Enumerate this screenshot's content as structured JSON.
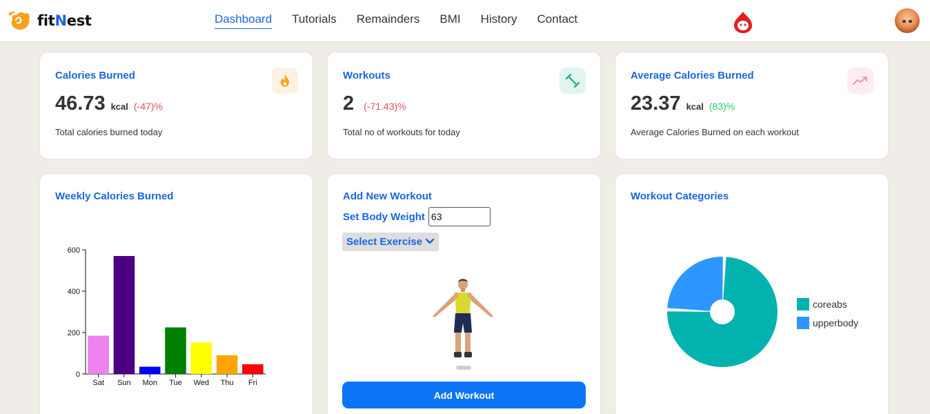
{
  "app": {
    "logo_prefix": "fit",
    "logo_accent": "N",
    "logo_suffix": "est"
  },
  "nav": {
    "items": [
      {
        "label": "Dashboard",
        "active": true
      },
      {
        "label": "Tutorials",
        "active": false
      },
      {
        "label": "Remainders",
        "active": false
      },
      {
        "label": "BMI",
        "active": false
      },
      {
        "label": "History",
        "active": false
      },
      {
        "label": "Contact",
        "active": false
      }
    ]
  },
  "stats": {
    "calories": {
      "title": "Calories Burned",
      "value": "46.73",
      "unit": "kcal",
      "change": "(-47)%",
      "desc": "Total calories burned today",
      "icon": "fire-icon"
    },
    "workouts": {
      "title": "Workouts",
      "value": "2",
      "unit": "",
      "change": "(-71.43)%",
      "desc": "Total no of workouts for today",
      "icon": "dumbbell-icon"
    },
    "average": {
      "title": "Average Calories Burned",
      "value": "23.37",
      "unit": "kcal",
      "change": "(83)%",
      "desc": "Average Calories Burned on each workout",
      "icon": "trending-up-icon"
    }
  },
  "weekly": {
    "title": "Weekly Calories Burned"
  },
  "add_workout": {
    "title": "Add New Workout",
    "body_weight_label": "Set Body Weight",
    "body_weight_value": "63",
    "select_label": "Select Exercise",
    "button_label": "Add Workout"
  },
  "categories": {
    "title": "Workout Categories"
  },
  "colors": {
    "accent": "#1a66e0",
    "negative": "#e05252",
    "positive": "#28c76f",
    "button": "#0d74f5"
  },
  "chart_data": [
    {
      "type": "bar",
      "title": "Weekly Calories Burned",
      "categories": [
        "Sat",
        "Sun",
        "Mon",
        "Tue",
        "Wed",
        "Thu",
        "Fri"
      ],
      "values": [
        185,
        570,
        35,
        225,
        152,
        90,
        47
      ],
      "colors": [
        "#ee82ee",
        "#4b0082",
        "#0000ff",
        "#008000",
        "#ffff00",
        "#ffa500",
        "#ff0000"
      ],
      "yticks": [
        0,
        200,
        400,
        600
      ],
      "ylim": [
        0,
        600
      ],
      "grid": false,
      "xlabel": "",
      "ylabel": ""
    },
    {
      "type": "pie",
      "title": "Workout Categories",
      "labels": [
        "coreabs",
        "upperbody"
      ],
      "values": [
        75,
        25
      ],
      "colors": [
        "#02b2af",
        "#2e96ff"
      ],
      "legend": "right"
    }
  ]
}
